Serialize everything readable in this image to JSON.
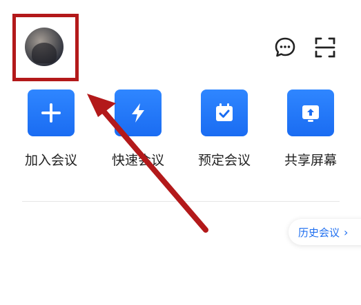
{
  "header": {
    "avatar": "user-avatar",
    "chat_icon": "chat-bubble-icon",
    "scan_icon": "scan-icon"
  },
  "actions": [
    {
      "label": "加入会议",
      "icon": "plus-icon"
    },
    {
      "label": "快速会议",
      "icon": "lightning-icon"
    },
    {
      "label": "预定会议",
      "icon": "calendar-check-icon"
    },
    {
      "label": "共享屏幕",
      "icon": "screen-share-icon"
    }
  ],
  "history": {
    "label": "历史会议",
    "chevron": "›"
  },
  "colors": {
    "accent": "#1f6ff0",
    "tile": "#1a6cf2",
    "highlight": "#b3191a"
  }
}
